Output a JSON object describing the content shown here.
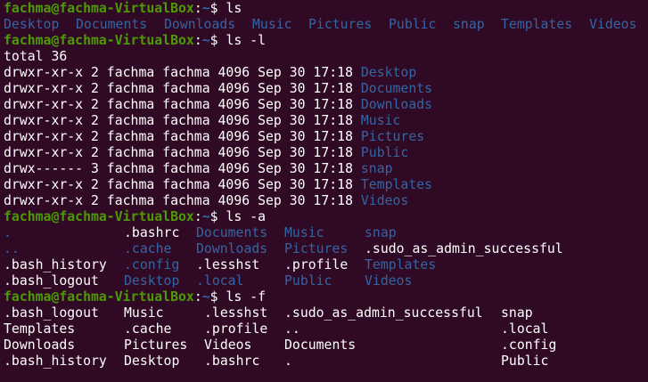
{
  "prompt": {
    "user_host": "fachma@fachma-VirtualBox",
    "separator": ":",
    "path": "~",
    "symbol": "$"
  },
  "commands": {
    "ls": "ls",
    "ls_l": "ls -l",
    "ls_a": "ls -a",
    "ls_f": "ls -f"
  },
  "ls_output": [
    "Desktop",
    "Documents",
    "Downloads",
    "Music",
    "Pictures",
    "Public",
    "snap",
    "Templates",
    "Videos"
  ],
  "ls_l": {
    "total": "total 36",
    "rows": [
      {
        "meta": "drwxr-xr-x 2 fachma fachma 4096 Sep 30 17:18",
        "name": "Desktop"
      },
      {
        "meta": "drwxr-xr-x 2 fachma fachma 4096 Sep 30 17:18",
        "name": "Documents"
      },
      {
        "meta": "drwxr-xr-x 2 fachma fachma 4096 Sep 30 17:18",
        "name": "Downloads"
      },
      {
        "meta": "drwxr-xr-x 2 fachma fachma 4096 Sep 30 17:18",
        "name": "Music"
      },
      {
        "meta": "drwxr-xr-x 2 fachma fachma 4096 Sep 30 17:18",
        "name": "Pictures"
      },
      {
        "meta": "drwxr-xr-x 2 fachma fachma 4096 Sep 30 17:18",
        "name": "Public"
      },
      {
        "meta": "drwx------ 3 fachma fachma 4096 Sep 30 17:18",
        "name": "snap"
      },
      {
        "meta": "drwxr-xr-x 2 fachma fachma 4096 Sep 30 17:18",
        "name": "Templates"
      },
      {
        "meta": "drwxr-xr-x 2 fachma fachma 4096 Sep 30 17:18",
        "name": "Videos"
      }
    ]
  },
  "ls_a": {
    "rows": [
      [
        {
          "t": ".",
          "dir": true
        },
        {
          "t": ".bashrc",
          "dir": false
        },
        {
          "t": "Documents",
          "dir": true
        },
        {
          "t": "Music",
          "dir": true
        },
        {
          "t": "snap",
          "dir": true
        }
      ],
      [
        {
          "t": "..",
          "dir": true
        },
        {
          "t": ".cache",
          "dir": true
        },
        {
          "t": "Downloads",
          "dir": true
        },
        {
          "t": "Pictures",
          "dir": true
        },
        {
          "t": ".sudo_as_admin_successful",
          "dir": false
        }
      ],
      [
        {
          "t": ".bash_history",
          "dir": false
        },
        {
          "t": ".config",
          "dir": true
        },
        {
          "t": ".lesshst",
          "dir": false
        },
        {
          "t": ".profile",
          "dir": false
        },
        {
          "t": "Templates",
          "dir": true
        }
      ],
      [
        {
          "t": ".bash_logout",
          "dir": false
        },
        {
          "t": "Desktop",
          "dir": true
        },
        {
          "t": ".local",
          "dir": true
        },
        {
          "t": "Public",
          "dir": true
        },
        {
          "t": "Videos",
          "dir": true
        }
      ]
    ]
  },
  "ls_f": {
    "rows": [
      [
        ".bash_logout",
        "Music",
        ".lesshst",
        ".sudo_as_admin_successful",
        "snap"
      ],
      [
        "Templates",
        ".cache",
        ".profile",
        "..",
        ".local"
      ],
      [
        "Downloads",
        "Pictures",
        "Videos",
        "Documents",
        ".config"
      ],
      [
        ".bash_history",
        "Desktop",
        ".bashrc",
        ".",
        "Public"
      ]
    ]
  },
  "colors": {
    "background": "#300a24",
    "prompt_user": "#4e9a06",
    "prompt_path": "#3465a4",
    "directory": "#3465a4",
    "text": "#ffffff"
  }
}
